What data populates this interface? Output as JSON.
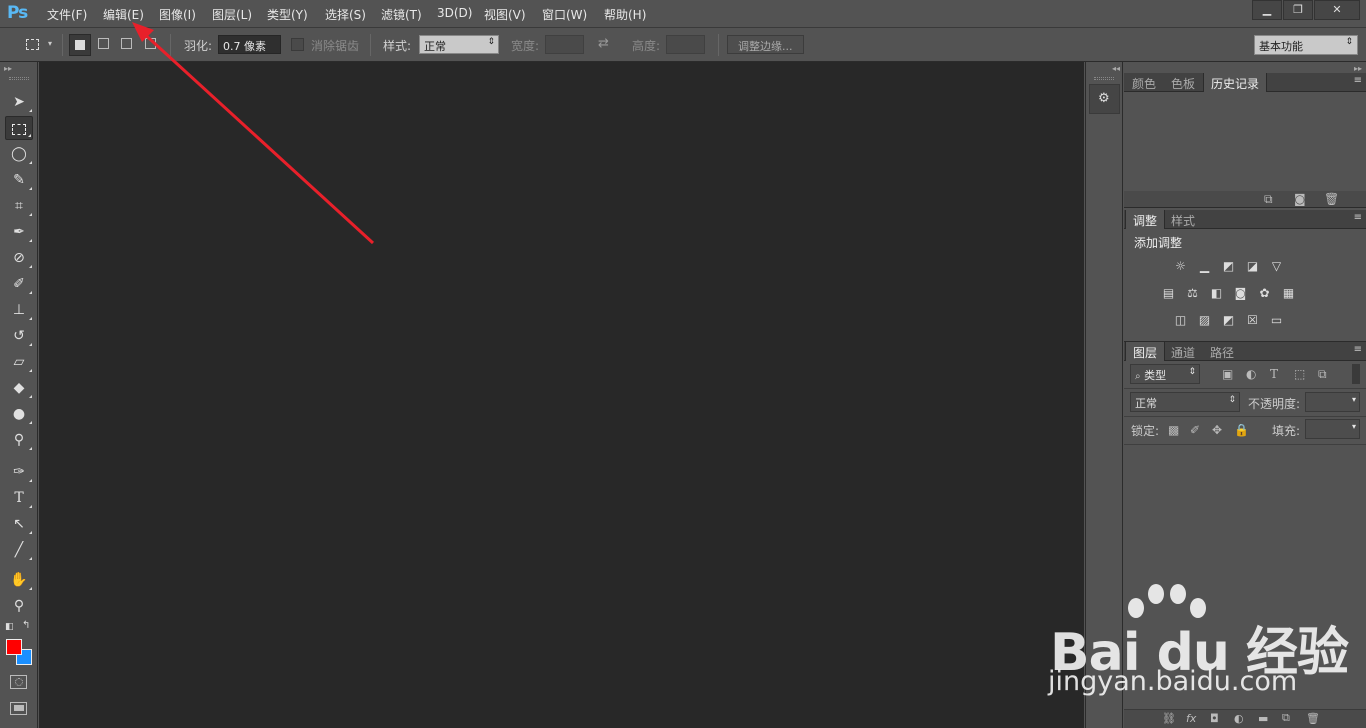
{
  "app": {
    "logo": "Ps"
  },
  "menu": [
    "文件(F)",
    "编辑(E)",
    "图像(I)",
    "图层(L)",
    "类型(Y)",
    "选择(S)",
    "滤镜(T)",
    "3D(D)",
    "视图(V)",
    "窗口(W)",
    "帮助(H)"
  ],
  "window_controls": {
    "minimize": "▁",
    "restore": "❐",
    "close": "✕"
  },
  "options": {
    "feather_label": "羽化:",
    "feather_value": "0.7 像素",
    "antialias_label": "消除锯齿",
    "style_label": "样式:",
    "style_value": "正常",
    "width_label": "宽度:",
    "height_label": "高度:",
    "refine_edge": "调整边缘...",
    "workspace": "基本功能"
  },
  "panels": {
    "top_tabs": [
      "颜色",
      "色板",
      "历史记录"
    ],
    "adjust_tabs": [
      "调整",
      "样式"
    ],
    "adjust_title": "添加调整",
    "layer_tabs": [
      "图层",
      "通道",
      "路径"
    ],
    "filter_kind": "类型",
    "blend_mode": "正常",
    "opacity_label": "不透明度:",
    "lock_label": "锁定:",
    "fill_label": "填充:"
  },
  "colors": {
    "foreground": "#ff0000",
    "background": "#1a8fff",
    "annotation_arrow": "#e8202a"
  },
  "watermark": {
    "brand": "Bai du 经验",
    "url": "jingyan.baidu.com"
  }
}
